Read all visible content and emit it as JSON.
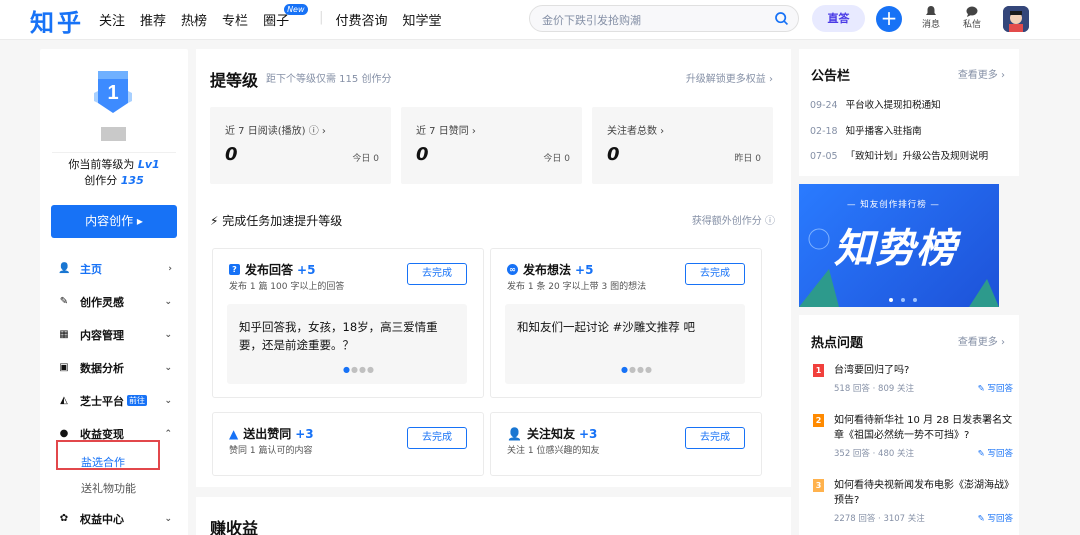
{
  "topbar": {
    "logo": "知乎",
    "nav": [
      "关注",
      "推荐",
      "热榜",
      "专栏",
      "圈子",
      "付费咨询",
      "知学堂"
    ],
    "new_badge": "New",
    "search_placeholder": "金价下跌引发抢购潮",
    "zhida": "直答",
    "add": "+",
    "messages": "消息",
    "inbox": "私信"
  },
  "left": {
    "level_badge": "1",
    "level_prefix": "你当前等级为",
    "level_value": "Lv1",
    "score_prefix": "创作分",
    "score_value": "135",
    "create_button": "内容创作 ▸",
    "menu": [
      {
        "label": "主页",
        "icon": "home-icon",
        "arrow": "›"
      },
      {
        "label": "创作灵感",
        "icon": "pen-icon",
        "arrow": "⌄"
      },
      {
        "label": "内容管理",
        "icon": "grid-icon",
        "arrow": "⌄"
      },
      {
        "label": "数据分析",
        "icon": "chart-icon",
        "arrow": "⌄"
      },
      {
        "label": "芝士平台",
        "icon": "cheese-icon",
        "arrow": "⌄",
        "tag": "前往"
      },
      {
        "label": "收益变现",
        "icon": "money-bag-icon",
        "arrow": "⌃"
      }
    ],
    "submenu": [
      "盐选合作",
      "送礼物功能"
    ],
    "last_menu": {
      "label": "权益中心",
      "icon": "leaf-icon",
      "arrow": "⌄"
    }
  },
  "center": {
    "title": "提等级",
    "subtitle": "距下个等级仅需 115 创作分",
    "upgrade_link": "升级解锁更多权益 ›",
    "stats": [
      {
        "label": "近 7 日阅读(播放) ⓘ ›",
        "value": "0",
        "right": "今日 0"
      },
      {
        "label": "近 7 日赞同 ›",
        "value": "0",
        "right": "今日 0"
      },
      {
        "label": "关注者总数 ›",
        "value": "0",
        "right": "昨日 0"
      }
    ],
    "task_heading": "⚡ 完成任务加速提升等级",
    "task_extra": "获得额外创作分 ⓘ",
    "tasks": [
      {
        "title": "发布回答",
        "points": "+5",
        "desc": "发布 1 篇 100 字以上的回答",
        "button": "去完成",
        "question": "知乎回答我，女孩，18岁，高三爱情重要，还是前途重要。？"
      },
      {
        "title": "发布想法",
        "points": "+5",
        "desc": "发布 1 条 20 字以上带 3 图的想法",
        "button": "去完成",
        "question": "和知友们一起讨论 #沙雕文推荐 吧"
      },
      {
        "title": "送出赞同",
        "points": "+3",
        "desc": "赞同 1 篇认可的内容",
        "button": "去完成"
      },
      {
        "title": "关注知友",
        "points": "+3",
        "desc": "关注 1 位感兴趣的知友",
        "button": "去完成"
      }
    ],
    "earn_title": "赚收益"
  },
  "announce": {
    "title": "公告栏",
    "more": "查看更多 ›",
    "items": [
      {
        "date": "09-24",
        "text": "平台收入提现扣税通知"
      },
      {
        "date": "02-18",
        "text": "知乎播客入驻指南"
      },
      {
        "date": "07-05",
        "text": "「致知计划」升级公告及规则说明"
      }
    ]
  },
  "banner": {
    "top": "— 知友创作排行榜 —",
    "big": "知势榜"
  },
  "hot": {
    "title": "热点问题",
    "more": "查看更多 ›",
    "write": "✎ 写回答",
    "items": [
      {
        "rank": "1",
        "title": "台湾要回归了吗?",
        "meta": "518 回答 · 809 关注",
        "color": "#f1403c"
      },
      {
        "rank": "2",
        "title": "如何看待新华社 10 月 28 日发表署名文章《祖国必然统一势不可挡》?",
        "meta": "352 回答 · 480 关注",
        "color": "#ff8a00"
      },
      {
        "rank": "3",
        "title": "如何看待央视新闻发布电影《澎湖海战》预告?",
        "meta": "2278 回答 · 3107 关注",
        "color": "#ffb24d"
      }
    ]
  }
}
